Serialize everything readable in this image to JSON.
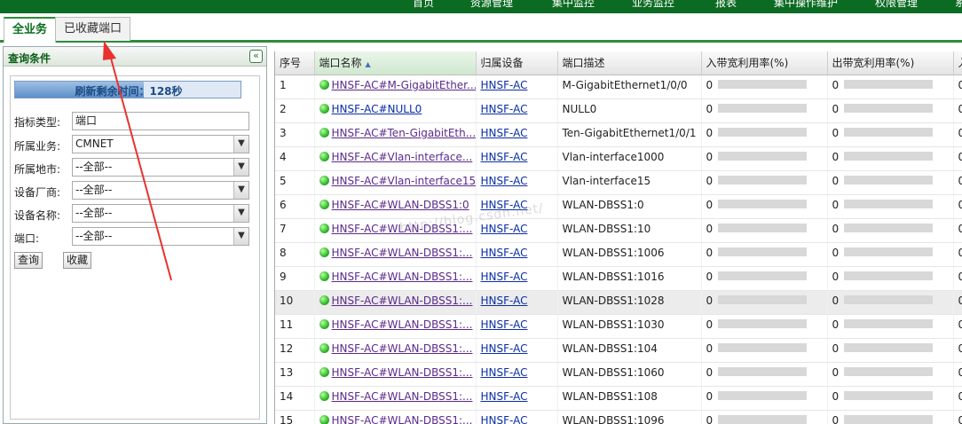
{
  "topnav": {
    "items": [
      "首页",
      "资源管理",
      "集中监控",
      "业务监控",
      "报表",
      "集中操作维护",
      "权限管理",
      "系"
    ]
  },
  "tabs": [
    {
      "label": "全业务",
      "active": true
    },
    {
      "label": "已收藏端口",
      "active": false
    }
  ],
  "query": {
    "title": "查询条件",
    "refresh_text": "刷新剩余时间：128秒",
    "refresh_progress": 0.57,
    "labels": {
      "metric_type": "指标类型:",
      "business": "所属业务:",
      "region": "所属地市:",
      "vendor": "设备厂商:",
      "device": "设备名称:",
      "port": "端口:"
    },
    "values": {
      "metric_type": "端口",
      "business": "CMNET",
      "region": "--全部--",
      "vendor": "--全部--",
      "device": "--全部--",
      "port": "--全部--"
    },
    "buttons": {
      "query": "查询",
      "favorite": "收藏"
    }
  },
  "table": {
    "headers": [
      "序号",
      "端口名称",
      "归属设备",
      "端口描述",
      "入带宽利用率(%)",
      "出带宽利用率(%)",
      "入"
    ],
    "rows": [
      {
        "no": "1",
        "name": "HNSF-AC#M-GigabitEther...",
        "device": "HNSF-AC",
        "desc": "M-GigabitEthernet1/0/0",
        "in": "0",
        "out": "0",
        "visited": true
      },
      {
        "no": "2",
        "name": "HNSF-AC#NULL0",
        "device": "HNSF-AC",
        "desc": "NULL0",
        "in": "0",
        "out": "0",
        "visited": false
      },
      {
        "no": "3",
        "name": "HNSF-AC#Ten-GigabitEth...",
        "device": "HNSF-AC",
        "desc": "Ten-GigabitEthernet1/0/1",
        "in": "0",
        "out": "0",
        "visited": true
      },
      {
        "no": "4",
        "name": "HNSF-AC#Vlan-interface...",
        "device": "HNSF-AC",
        "desc": "Vlan-interface1000",
        "in": "0",
        "out": "0",
        "visited": true
      },
      {
        "no": "5",
        "name": "HNSF-AC#Vlan-interface15",
        "device": "HNSF-AC",
        "desc": "Vlan-interface15",
        "in": "0",
        "out": "0",
        "visited": true
      },
      {
        "no": "6",
        "name": "HNSF-AC#WLAN-DBSS1:0",
        "device": "HNSF-AC",
        "desc": "WLAN-DBSS1:0",
        "in": "0",
        "out": "0",
        "visited": true
      },
      {
        "no": "7",
        "name": "HNSF-AC#WLAN-DBSS1:...",
        "device": "HNSF-AC",
        "desc": "WLAN-DBSS1:10",
        "in": "0",
        "out": "0",
        "visited": true
      },
      {
        "no": "8",
        "name": "HNSF-AC#WLAN-DBSS1:...",
        "device": "HNSF-AC",
        "desc": "WLAN-DBSS1:1006",
        "in": "0",
        "out": "0",
        "visited": true
      },
      {
        "no": "9",
        "name": "HNSF-AC#WLAN-DBSS1:...",
        "device": "HNSF-AC",
        "desc": "WLAN-DBSS1:1016",
        "in": "0",
        "out": "0",
        "visited": true
      },
      {
        "no": "10",
        "name": "HNSF-AC#WLAN-DBSS1:...",
        "device": "HNSF-AC",
        "desc": "WLAN-DBSS1:1028",
        "in": "0",
        "out": "0",
        "visited": true,
        "highlight": true
      },
      {
        "no": "11",
        "name": "HNSF-AC#WLAN-DBSS1:...",
        "device": "HNSF-AC",
        "desc": "WLAN-DBSS1:1030",
        "in": "0",
        "out": "0",
        "visited": true
      },
      {
        "no": "12",
        "name": "HNSF-AC#WLAN-DBSS1:...",
        "device": "HNSF-AC",
        "desc": "WLAN-DBSS1:104",
        "in": "0",
        "out": "0",
        "visited": true
      },
      {
        "no": "13",
        "name": "HNSF-AC#WLAN-DBSS1:...",
        "device": "HNSF-AC",
        "desc": "WLAN-DBSS1:1060",
        "in": "0",
        "out": "0",
        "visited": true
      },
      {
        "no": "14",
        "name": "HNSF-AC#WLAN-DBSS1:...",
        "device": "HNSF-AC",
        "desc": "WLAN-DBSS1:108",
        "in": "0",
        "out": "0",
        "visited": true
      },
      {
        "no": "15",
        "name": "HNSF-AC#WLAN-DBSS1:...",
        "device": "HNSF-AC",
        "desc": "WLAN-DBSS1:1096",
        "in": "0",
        "out": "0",
        "visited": true
      }
    ]
  },
  "watermark": "http://blog.csdn.net/",
  "colors": {
    "nav_green": "#0c6b22",
    "link_blue": "#0a2ea8",
    "status_green": "#2fb82a",
    "annotation_red": "#e8322f"
  }
}
